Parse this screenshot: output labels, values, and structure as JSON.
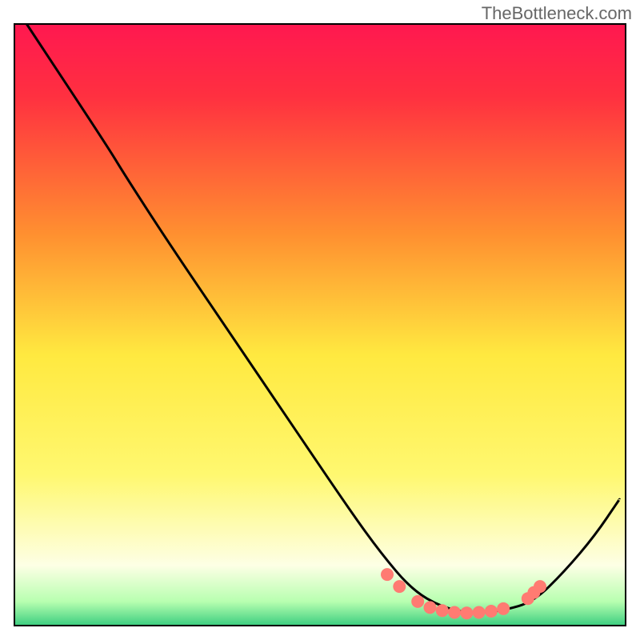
{
  "attribution": "TheBottleneck.com",
  "chart_data": {
    "type": "line",
    "title": "",
    "xlabel": "",
    "ylabel": "",
    "xlim": [
      0,
      100
    ],
    "ylim": [
      0,
      100
    ],
    "gradient_colors": {
      "top": "#ff1850",
      "middle": "#ffe940",
      "lower": "#fdffe5",
      "bottom": "#3cce80"
    },
    "curve": {
      "description": "V-shaped bottleneck curve descending from top-left, reaching minimum near x~70-80, then rising",
      "points": [
        {
          "x": 2,
          "y": 100
        },
        {
          "x": 15,
          "y": 80
        },
        {
          "x": 18,
          "y": 75
        },
        {
          "x": 25,
          "y": 64
        },
        {
          "x": 35,
          "y": 49
        },
        {
          "x": 45,
          "y": 34
        },
        {
          "x": 55,
          "y": 19
        },
        {
          "x": 60,
          "y": 12
        },
        {
          "x": 65,
          "y": 6
        },
        {
          "x": 70,
          "y": 3
        },
        {
          "x": 75,
          "y": 2
        },
        {
          "x": 80,
          "y": 2.5
        },
        {
          "x": 85,
          "y": 4
        },
        {
          "x": 90,
          "y": 9
        },
        {
          "x": 95,
          "y": 15
        },
        {
          "x": 99,
          "y": 21
        }
      ]
    },
    "markers": {
      "color": "#ff7b72",
      "points": [
        {
          "x": 61,
          "y": 8.5
        },
        {
          "x": 63,
          "y": 6.5
        },
        {
          "x": 66,
          "y": 4
        },
        {
          "x": 68,
          "y": 3
        },
        {
          "x": 70,
          "y": 2.5
        },
        {
          "x": 72,
          "y": 2.2
        },
        {
          "x": 74,
          "y": 2.1
        },
        {
          "x": 76,
          "y": 2.2
        },
        {
          "x": 78,
          "y": 2.4
        },
        {
          "x": 80,
          "y": 2.8
        },
        {
          "x": 84,
          "y": 4.5
        },
        {
          "x": 85,
          "y": 5.5
        },
        {
          "x": 86,
          "y": 6.5
        }
      ]
    }
  }
}
